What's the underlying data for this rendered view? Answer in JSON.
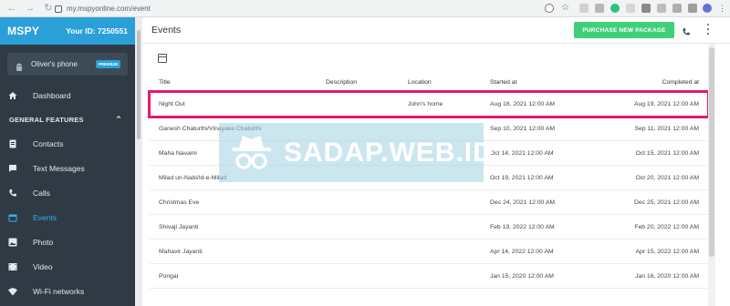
{
  "browser": {
    "url": "my.mspyonline.com/event"
  },
  "sidebar": {
    "logo": "MSPY",
    "user_id": "Your ID: 7250551",
    "device": {
      "name": "Oliver's phone",
      "badge": "PREMIUM"
    },
    "dashboard": "Dashboard",
    "section": "GENERAL FEATURES",
    "items": [
      {
        "label": "Contacts",
        "icon": "contacts-icon"
      },
      {
        "label": "Text Messages",
        "icon": "chat-icon"
      },
      {
        "label": "Calls",
        "icon": "phone-icon"
      },
      {
        "label": "Events",
        "icon": "calendar-icon",
        "active": true
      },
      {
        "label": "Photo",
        "icon": "photo-icon"
      },
      {
        "label": "Video",
        "icon": "video-icon"
      },
      {
        "label": "Wi-Fi networks",
        "icon": "wifi-icon"
      }
    ]
  },
  "main": {
    "title": "Events",
    "purchase_label": "PURCHASE NEW PACKAGE",
    "table": {
      "headers": [
        "Title",
        "Description",
        "Location",
        "Started at",
        "Completed at"
      ],
      "rows": [
        {
          "title": "Night Out",
          "description": "",
          "location": "John's home",
          "started": "Aug 18, 2021 12:00 AM",
          "completed": "Aug 19, 2021 12:00 AM"
        },
        {
          "title": "Ganesh Chaturthi/Vinayaka Chaturthi",
          "description": "",
          "location": "",
          "started": "Sep 10, 2021 12:00 AM",
          "completed": "Sep 11, 2021 12:00 AM"
        },
        {
          "title": "Maha Navami",
          "description": "",
          "location": "",
          "started": "Oct 14, 2021 12:00 AM",
          "completed": "Oct 15, 2021 12:00 AM"
        },
        {
          "title": "Milad un-Nabi/Id-e-Milad",
          "description": "",
          "location": "",
          "started": "Oct 19, 2021 12:00 AM",
          "completed": "Oct 20, 2021 12:00 AM"
        },
        {
          "title": "Christmas Eve",
          "description": "",
          "location": "",
          "started": "Dec 24, 2021 12:00 AM",
          "completed": "Dec 25, 2021 12:00 AM"
        },
        {
          "title": "Shivaji Jayanti",
          "description": "",
          "location": "",
          "started": "Feb 19, 2022 12:00 AM",
          "completed": "Feb 20, 2022 12:00 AM"
        },
        {
          "title": "Mahavir Jayanti",
          "description": "",
          "location": "",
          "started": "Apr 14, 2022 12:00 AM",
          "completed": "Apr 15, 2022 12:00 AM"
        },
        {
          "title": "Pongal",
          "description": "",
          "location": "",
          "started": "Jan 15, 2020 12:00 AM",
          "completed": "Jan 16, 2020 12:00 AM"
        }
      ]
    }
  },
  "watermark": {
    "text": "SADAP.WEB.ID"
  },
  "colors": {
    "accent": "#2b9fd8",
    "sidebar": "#2f3a45",
    "purchase": "#3fcf7b",
    "highlight": "#e6186e"
  }
}
